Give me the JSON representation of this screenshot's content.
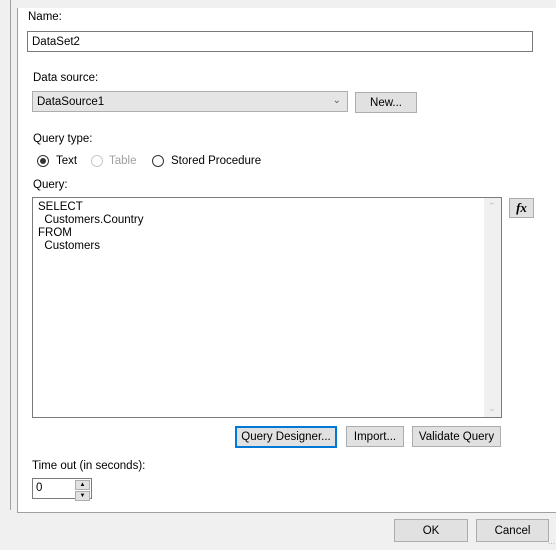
{
  "name": {
    "label": "Name:",
    "value": "DataSet2"
  },
  "data_source": {
    "label": "Data source:",
    "selected": "DataSource1",
    "new_button": "New..."
  },
  "query_type": {
    "label": "Query type:",
    "options": [
      {
        "label": "Text",
        "checked": true,
        "enabled": true
      },
      {
        "label": "Table",
        "checked": false,
        "enabled": false
      },
      {
        "label": "Stored Procedure",
        "checked": false,
        "enabled": true
      }
    ]
  },
  "query": {
    "label": "Query:",
    "text": "SELECT\n  Customers.Country\nFROM\n  Customers",
    "expression_button": "fx"
  },
  "query_buttons": {
    "designer": "Query Designer...",
    "import": "Import...",
    "validate": "Validate Query"
  },
  "timeout": {
    "label": "Time out (in seconds):",
    "value": "0"
  },
  "footer": {
    "ok": "OK",
    "cancel": "Cancel"
  },
  "colors": {
    "focus_border": "#0078d7",
    "button_bg": "#e1e1e1",
    "dialog_bg": "#f0f0f0"
  }
}
